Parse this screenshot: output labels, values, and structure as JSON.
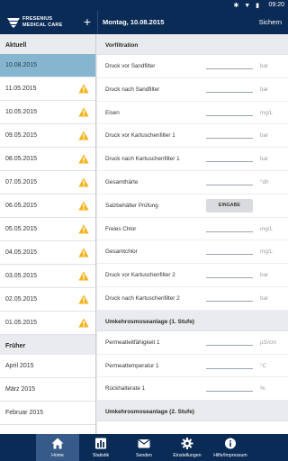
{
  "status_bar": {
    "icons": "✱ ▼ ▮",
    "time": "09:20"
  },
  "header": {
    "logo_line1": "FRESENIUS",
    "logo_line2": "MEDICAL CARE",
    "add_label": "+",
    "date": "Montag, 10.08.2015",
    "save_label": "Sichern"
  },
  "sidebar": {
    "current_heading": "Aktuell",
    "dates": [
      {
        "label": "10.08.2015",
        "warning": false,
        "active": true
      },
      {
        "label": "11.05.2015",
        "warning": true
      },
      {
        "label": "10.05.2015",
        "warning": true
      },
      {
        "label": "09.05.2015",
        "warning": true
      },
      {
        "label": "08.05.2015",
        "warning": true
      },
      {
        "label": "07.05.2015",
        "warning": true
      },
      {
        "label": "06.05.2015",
        "warning": true
      },
      {
        "label": "05.05.2015",
        "warning": true
      },
      {
        "label": "04.05.2015",
        "warning": true
      },
      {
        "label": "03.05.2015",
        "warning": true
      },
      {
        "label": "02.05.2015",
        "warning": true
      },
      {
        "label": "01.05.2015",
        "warning": true
      }
    ],
    "earlier_heading": "Früher",
    "months": [
      "April 2015",
      "März 2015",
      "Februar 2015"
    ]
  },
  "content": {
    "sections": [
      {
        "title": "Vorfiltration",
        "fields": [
          {
            "label": "Druck vor Sandfilter",
            "unit": "bar"
          },
          {
            "label": "Druck nach Sandfilter",
            "unit": "bar"
          },
          {
            "label": "Eisen",
            "unit": "mg/L"
          },
          {
            "label": "Druck vor Kartuschenfilter 1",
            "unit": "bar"
          },
          {
            "label": "Druck nach Kartuschenfilter 1",
            "unit": "bar"
          },
          {
            "label": "Gesamthärte",
            "unit": "°dh"
          },
          {
            "label": "Salzbehälter Prüfung",
            "button": "EINGABE"
          },
          {
            "label": "Freies Chlor",
            "unit": "mg/L"
          },
          {
            "label": "Gesamtchlor",
            "unit": "mg/L"
          },
          {
            "label": "Druck vor Kartuschenfilter 2",
            "unit": "bar"
          },
          {
            "label": "Druck nach Kartuschenfilter 2",
            "unit": "bar"
          }
        ]
      },
      {
        "title": "Umkehrosmoseanlage (1. Stufe)",
        "fields": [
          {
            "label": "Permeatleitfähigkeit 1",
            "unit": "µS/cm"
          },
          {
            "label": "Permeattemperatur 1",
            "unit": "°C"
          },
          {
            "label": "Rückhalterate 1",
            "unit": "%"
          }
        ]
      },
      {
        "title": "Umkehrosmoseanlage (2. Stufe)",
        "fields": []
      }
    ]
  },
  "bottom_nav": [
    {
      "label": "Home",
      "icon": "home-icon",
      "active": true
    },
    {
      "label": "Statistik",
      "icon": "statistics-icon"
    },
    {
      "label": "Senden",
      "icon": "mail-icon"
    },
    {
      "label": "Einstellungen",
      "icon": "gear-icon"
    },
    {
      "label": "Hilfe/Impressum",
      "icon": "info-icon"
    }
  ],
  "colors": {
    "header_bg": "#0b2b57",
    "active_row": "#86b6cf",
    "warning": "#f5b21b",
    "nav_active": "#365a89"
  }
}
